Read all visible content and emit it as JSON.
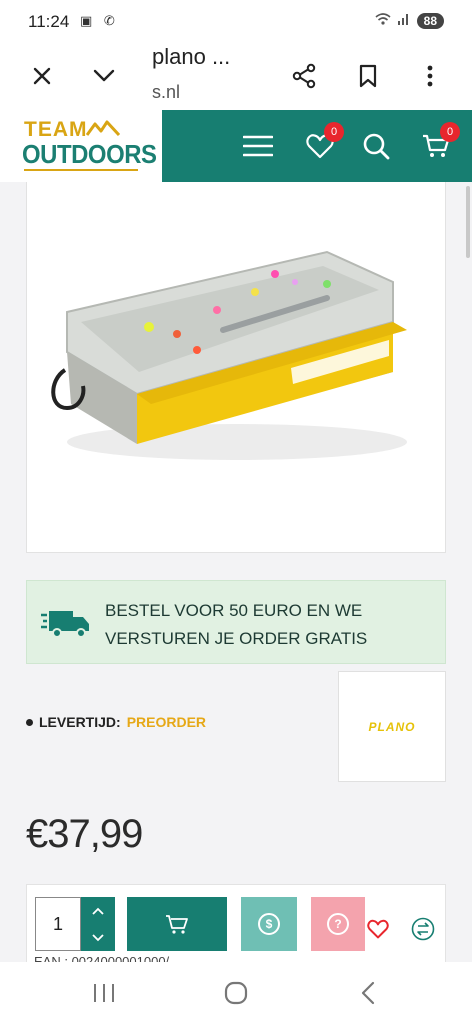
{
  "status": {
    "time": "11:24",
    "battery": "88"
  },
  "browser": {
    "title": "plano ...",
    "domain": "s.nl"
  },
  "site": {
    "logo_top": "TEAM",
    "logo_bottom": "OUTDOORS",
    "wishlist_count": "0",
    "cart_count": "0"
  },
  "shipping": {
    "text": "BESTEL VOOR 50 EURO EN WE VERSTUREN JE ORDER GRATIS"
  },
  "delivery": {
    "label": "LEVERTIJD:",
    "value": "PREORDER"
  },
  "brand": {
    "name": "PLANO"
  },
  "product": {
    "price": "€37,99",
    "quantity": "1",
    "ean": "EAN : 0024000001000/"
  },
  "colors": {
    "teal": "#177e71",
    "gold": "#d9a514",
    "badge_red": "#e8262d",
    "shipping_bg": "#e1f1e2"
  }
}
